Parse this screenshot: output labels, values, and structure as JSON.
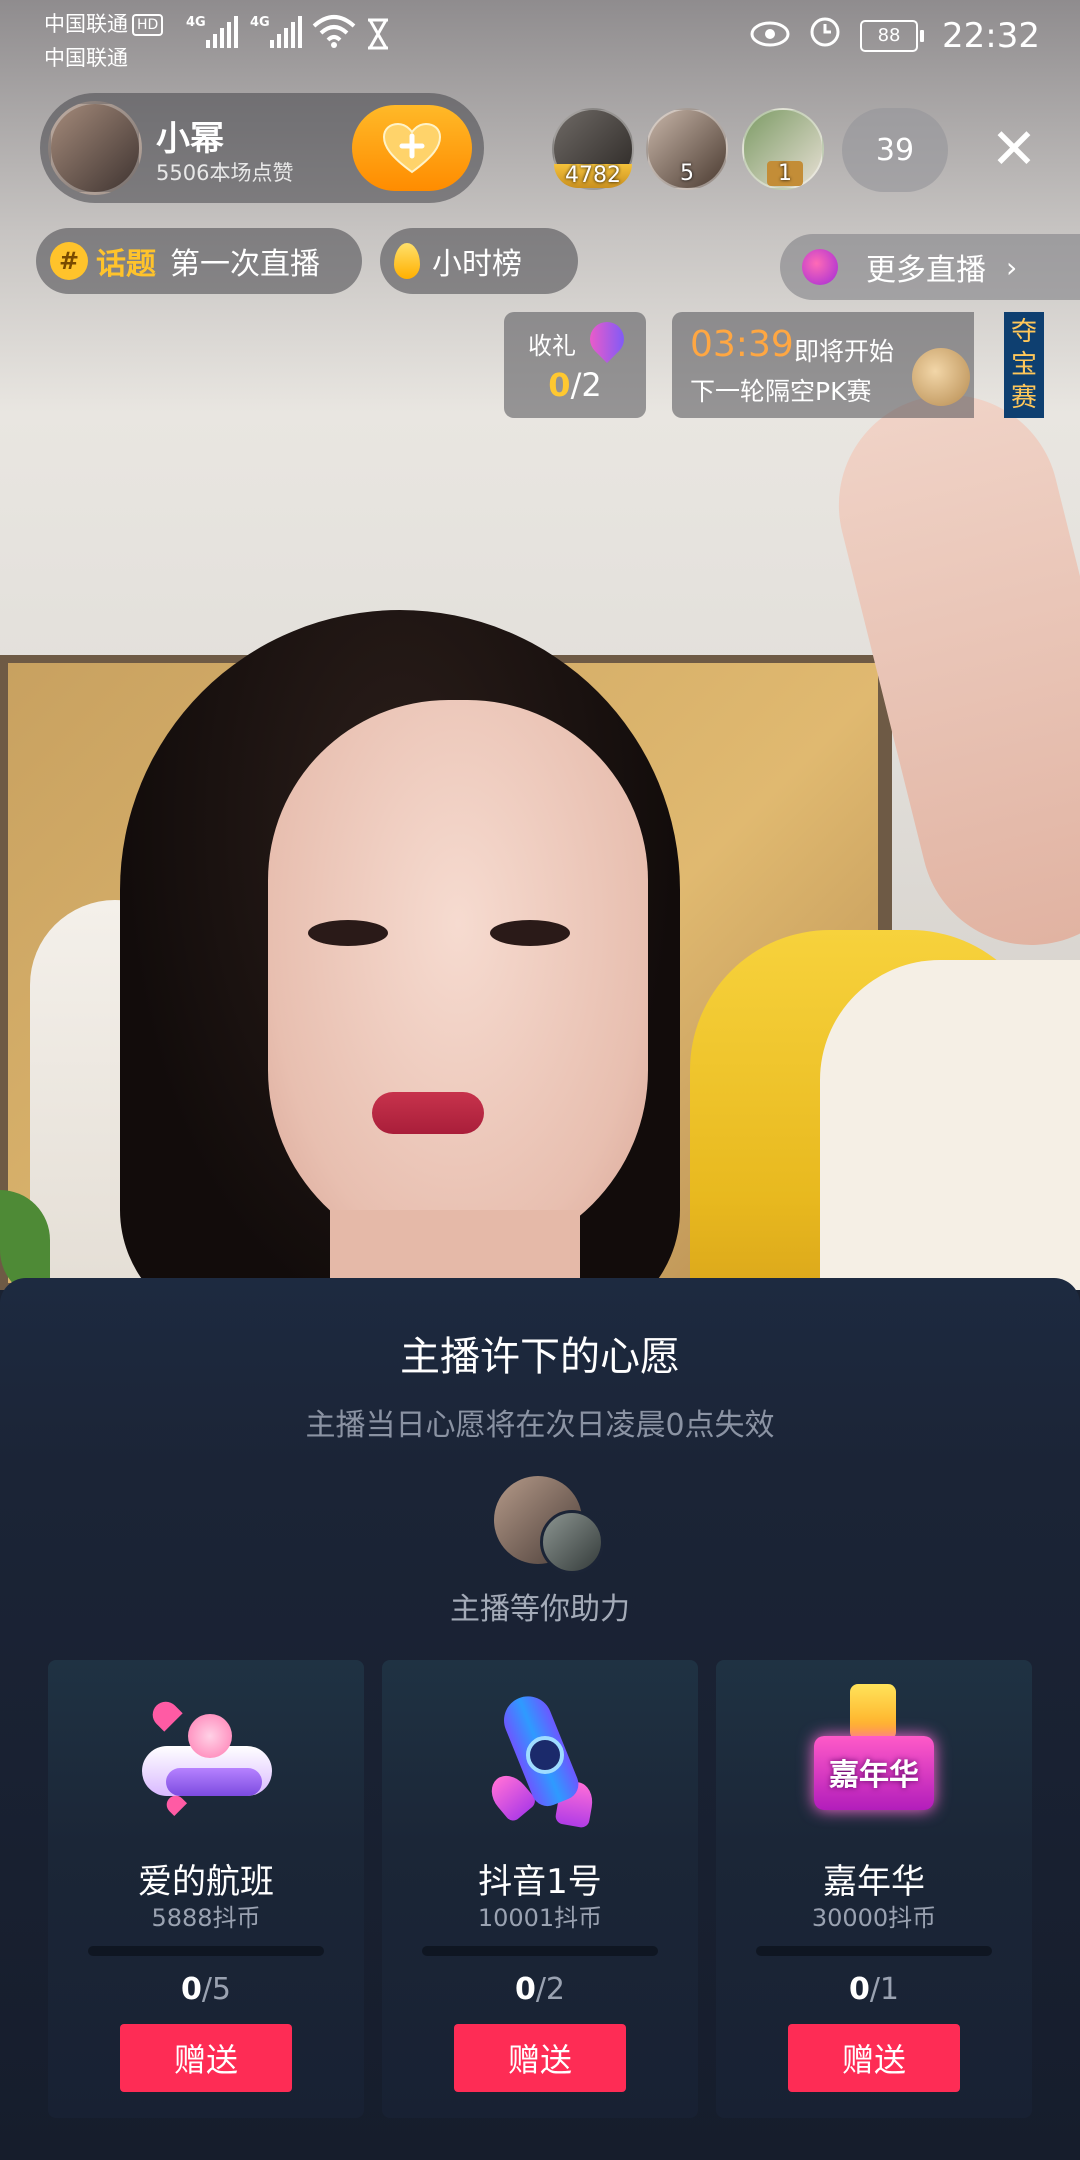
{
  "status_bar": {
    "carrier_1": "中国联通",
    "carrier_2": "中国联通",
    "hd_badge": "HD",
    "net_1": "4G",
    "net_2": "4G",
    "battery": "88",
    "time": "22:32"
  },
  "host": {
    "name": "小幂",
    "likes": "5506本场点赞",
    "follow_icon": "heart-plus-icon"
  },
  "viewers": {
    "top": [
      "4782",
      "5",
      "1"
    ],
    "total": "39",
    "close_glyph": "✕"
  },
  "tags": {
    "topic_icon": "#",
    "topic_label": "话题",
    "topic_text": "第一次直播",
    "hourly_rank": "小时榜",
    "more_live": "更多直播",
    "more_chevron": "›"
  },
  "gift_goal": {
    "label": "收礼",
    "current": "0",
    "total": "/2"
  },
  "pk": {
    "countdown": "03:39",
    "starting": "即将开始",
    "next_round": "下一轮隔空PK赛",
    "side_badge": "夺宝赛"
  },
  "wish_sheet": {
    "title": "主播许下的心愿",
    "subtitle": "主播当日心愿将在次日凌晨0点失效",
    "help_text": "主播等你助力",
    "gifts": [
      {
        "name": "爱的航班",
        "price": "5888抖币",
        "current": "0",
        "goal": "/5",
        "progress": 0,
        "button": "赠送"
      },
      {
        "name": "抖音1号",
        "price": "10001抖币",
        "current": "0",
        "goal": "/2",
        "progress": 0,
        "button": "赠送"
      },
      {
        "name": "嘉年华",
        "price": "30000抖币",
        "current": "0",
        "goal": "/1",
        "progress": 0,
        "button": "赠送"
      }
    ],
    "carnival_art_text": "嘉年华"
  },
  "colors": {
    "accent_red": "#fe2c55",
    "gold": "#ffc32b",
    "countdown_orange": "#ffa742"
  }
}
